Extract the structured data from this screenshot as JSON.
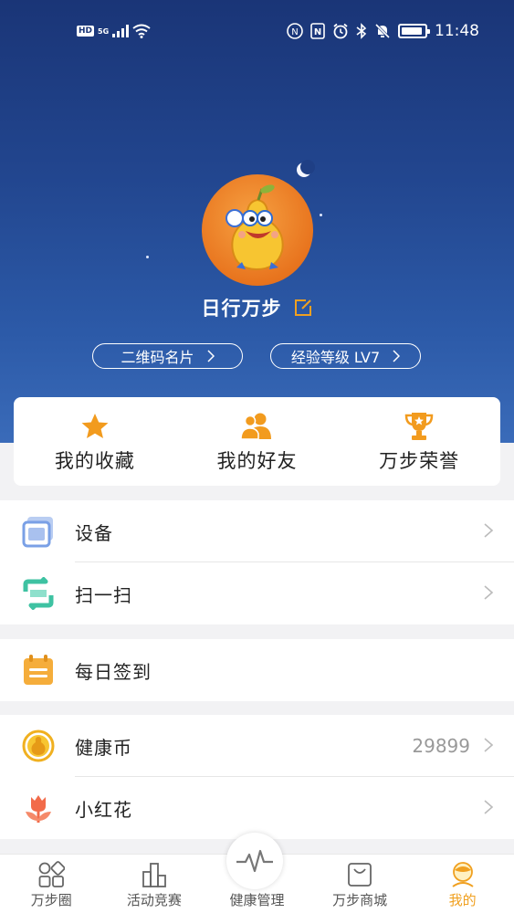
{
  "status_bar": {
    "hd": "HD",
    "network": "5G",
    "time": "11:48",
    "icons": [
      "signal-icon",
      "wifi-icon",
      "nfc-icon",
      "alarm-icon",
      "bluetooth-icon",
      "mute-icon",
      "battery-icon"
    ]
  },
  "profile": {
    "name": "日行万步",
    "qr_card_label": "二维码名片",
    "level_label": "经验等级 LV7"
  },
  "quick_actions": [
    {
      "label": "我的收藏",
      "icon": "star-icon"
    },
    {
      "label": "我的好友",
      "icon": "friends-icon"
    },
    {
      "label": "万步荣誉",
      "icon": "trophy-icon"
    }
  ],
  "menu": {
    "device": {
      "label": "设备",
      "icon": "device-icon"
    },
    "scan": {
      "label": "扫一扫",
      "icon": "scan-icon"
    },
    "checkin": {
      "label": "每日签到",
      "icon": "calendar-icon"
    },
    "coins": {
      "label": "健康币",
      "value": "29899",
      "icon": "coin-gourd-icon"
    },
    "flowers": {
      "label": "小红花",
      "icon": "tulip-icon"
    }
  },
  "tabbar": [
    {
      "label": "万步圈",
      "icon": "circle-grid-icon"
    },
    {
      "label": "活动竞赛",
      "icon": "bar-podium-icon"
    },
    {
      "label": "健康管理",
      "icon": "heartbeat-icon"
    },
    {
      "label": "万步商城",
      "icon": "shopping-bag-icon"
    },
    {
      "label": "我的",
      "icon": "profile-icon",
      "active": true
    }
  ],
  "colors": {
    "accent": "#f0a020",
    "header_top": "#1a3577",
    "header_bottom": "#3a6bb9"
  }
}
